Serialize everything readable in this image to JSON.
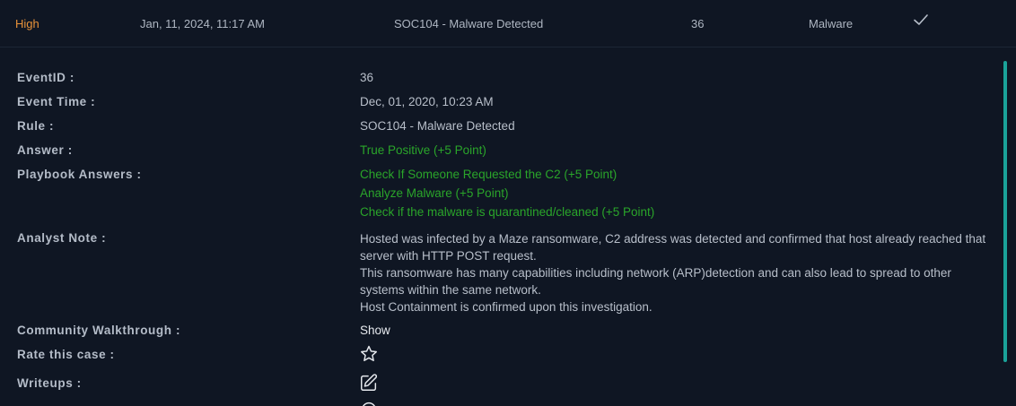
{
  "header": {
    "severity": "High",
    "date": "Jan, 11, 2024, 11:17 AM",
    "rule": "SOC104 - Malware Detected",
    "event_id": "36",
    "type": "Malware",
    "check_icon": "check-icon"
  },
  "details": {
    "event_id": {
      "label": "EventID :",
      "value": "36"
    },
    "event_time": {
      "label": "Event Time :",
      "value": "Dec, 01, 2020, 10:23 AM"
    },
    "rule": {
      "label": "Rule :",
      "value": "SOC104 - Malware Detected"
    },
    "answer": {
      "label": "Answer :",
      "value": "True Positive (+5 Point)"
    },
    "playbook": {
      "label": "Playbook Answers :",
      "items": [
        "Check If Someone Requested the C2 (+5 Point)",
        "Analyze Malware (+5 Point)",
        "Check if the malware is quarantined/cleaned (+5 Point)"
      ]
    },
    "analyst_note": {
      "label": "Analyst Note :",
      "lines": [
        "Hosted was infected by a Maze ransomware, C2 address was detected and confirmed that host already reached that server with HTTP POST request.",
        "This ransomware has many capabilities including network (ARP)detection and can also lead to spread to other systems within the same network.",
        "Host Containment is confirmed upon this investigation."
      ]
    },
    "walkthrough": {
      "label": "Community Walkthrough :",
      "value": "Show"
    },
    "rate": {
      "label": "Rate this case :",
      "icon": "star-icon"
    },
    "writeups": {
      "label": "Writeups :",
      "icon": "edit-icon"
    }
  },
  "colors": {
    "background": "#0f1623",
    "severity_high": "#e8923a",
    "positive_green": "#2aa52a",
    "scrollbar": "#1aa39a"
  }
}
